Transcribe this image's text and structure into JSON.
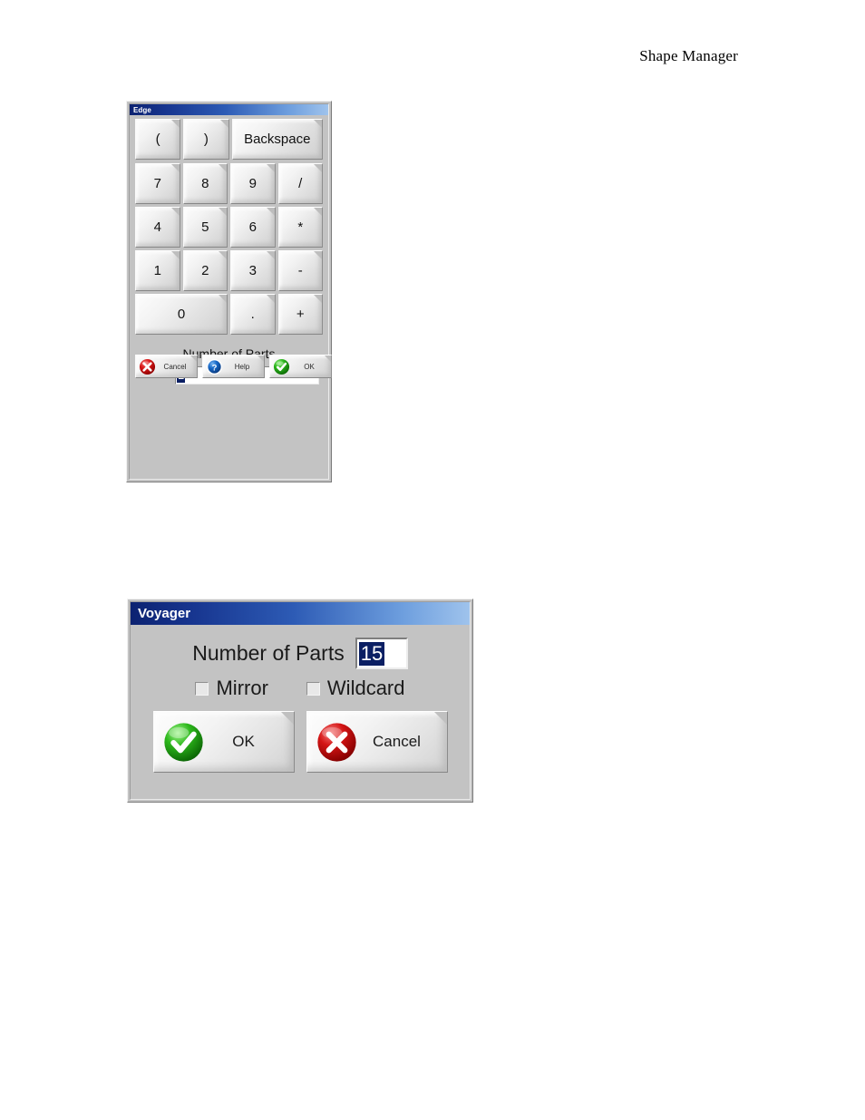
{
  "page": {
    "header_title": "Shape Manager"
  },
  "edge_dialog": {
    "title": "Edge",
    "keypad": {
      "row_top": [
        "(",
        ")",
        "Backspace"
      ],
      "rows": [
        [
          "7",
          "8",
          "9",
          "/"
        ],
        [
          "4",
          "5",
          "6",
          "*"
        ],
        [
          "1",
          "2",
          "3",
          "-"
        ]
      ],
      "row_bottom": [
        "0",
        ".",
        "+"
      ]
    },
    "number_of_parts": {
      "label": "Number of Parts",
      "value": "1",
      "placeholder": ""
    },
    "buttons": [
      {
        "label": "Cancel",
        "icon": "red-x-circle-icon",
        "color": "#c00b0b"
      },
      {
        "label": "Help",
        "icon": "blue-question-circle-icon",
        "color": "#1668c8"
      },
      {
        "label": "OK",
        "icon": "green-check-circle-icon",
        "color": "#27b019"
      }
    ]
  },
  "voyager_dialog": {
    "title": "Voyager",
    "number_of_parts": {
      "label": "Number of Parts",
      "value": "15",
      "placeholder": ""
    },
    "checkboxes": [
      {
        "label": "Mirror",
        "checked": false
      },
      {
        "label": "Wildcard",
        "checked": false
      }
    ],
    "buttons": [
      {
        "label": "OK",
        "icon": "green-check-circle-icon",
        "color": "#27b019"
      },
      {
        "label": "Cancel",
        "icon": "red-x-circle-icon",
        "color": "#c00b0b"
      }
    ]
  },
  "theme": {
    "dialog_face": "#c3c3c3",
    "titlebar_start": "#0c2271",
    "titlebar_end": "#9fc3ec",
    "selection_bg": "#0b1f63",
    "selection_fg": "#ffffff"
  }
}
